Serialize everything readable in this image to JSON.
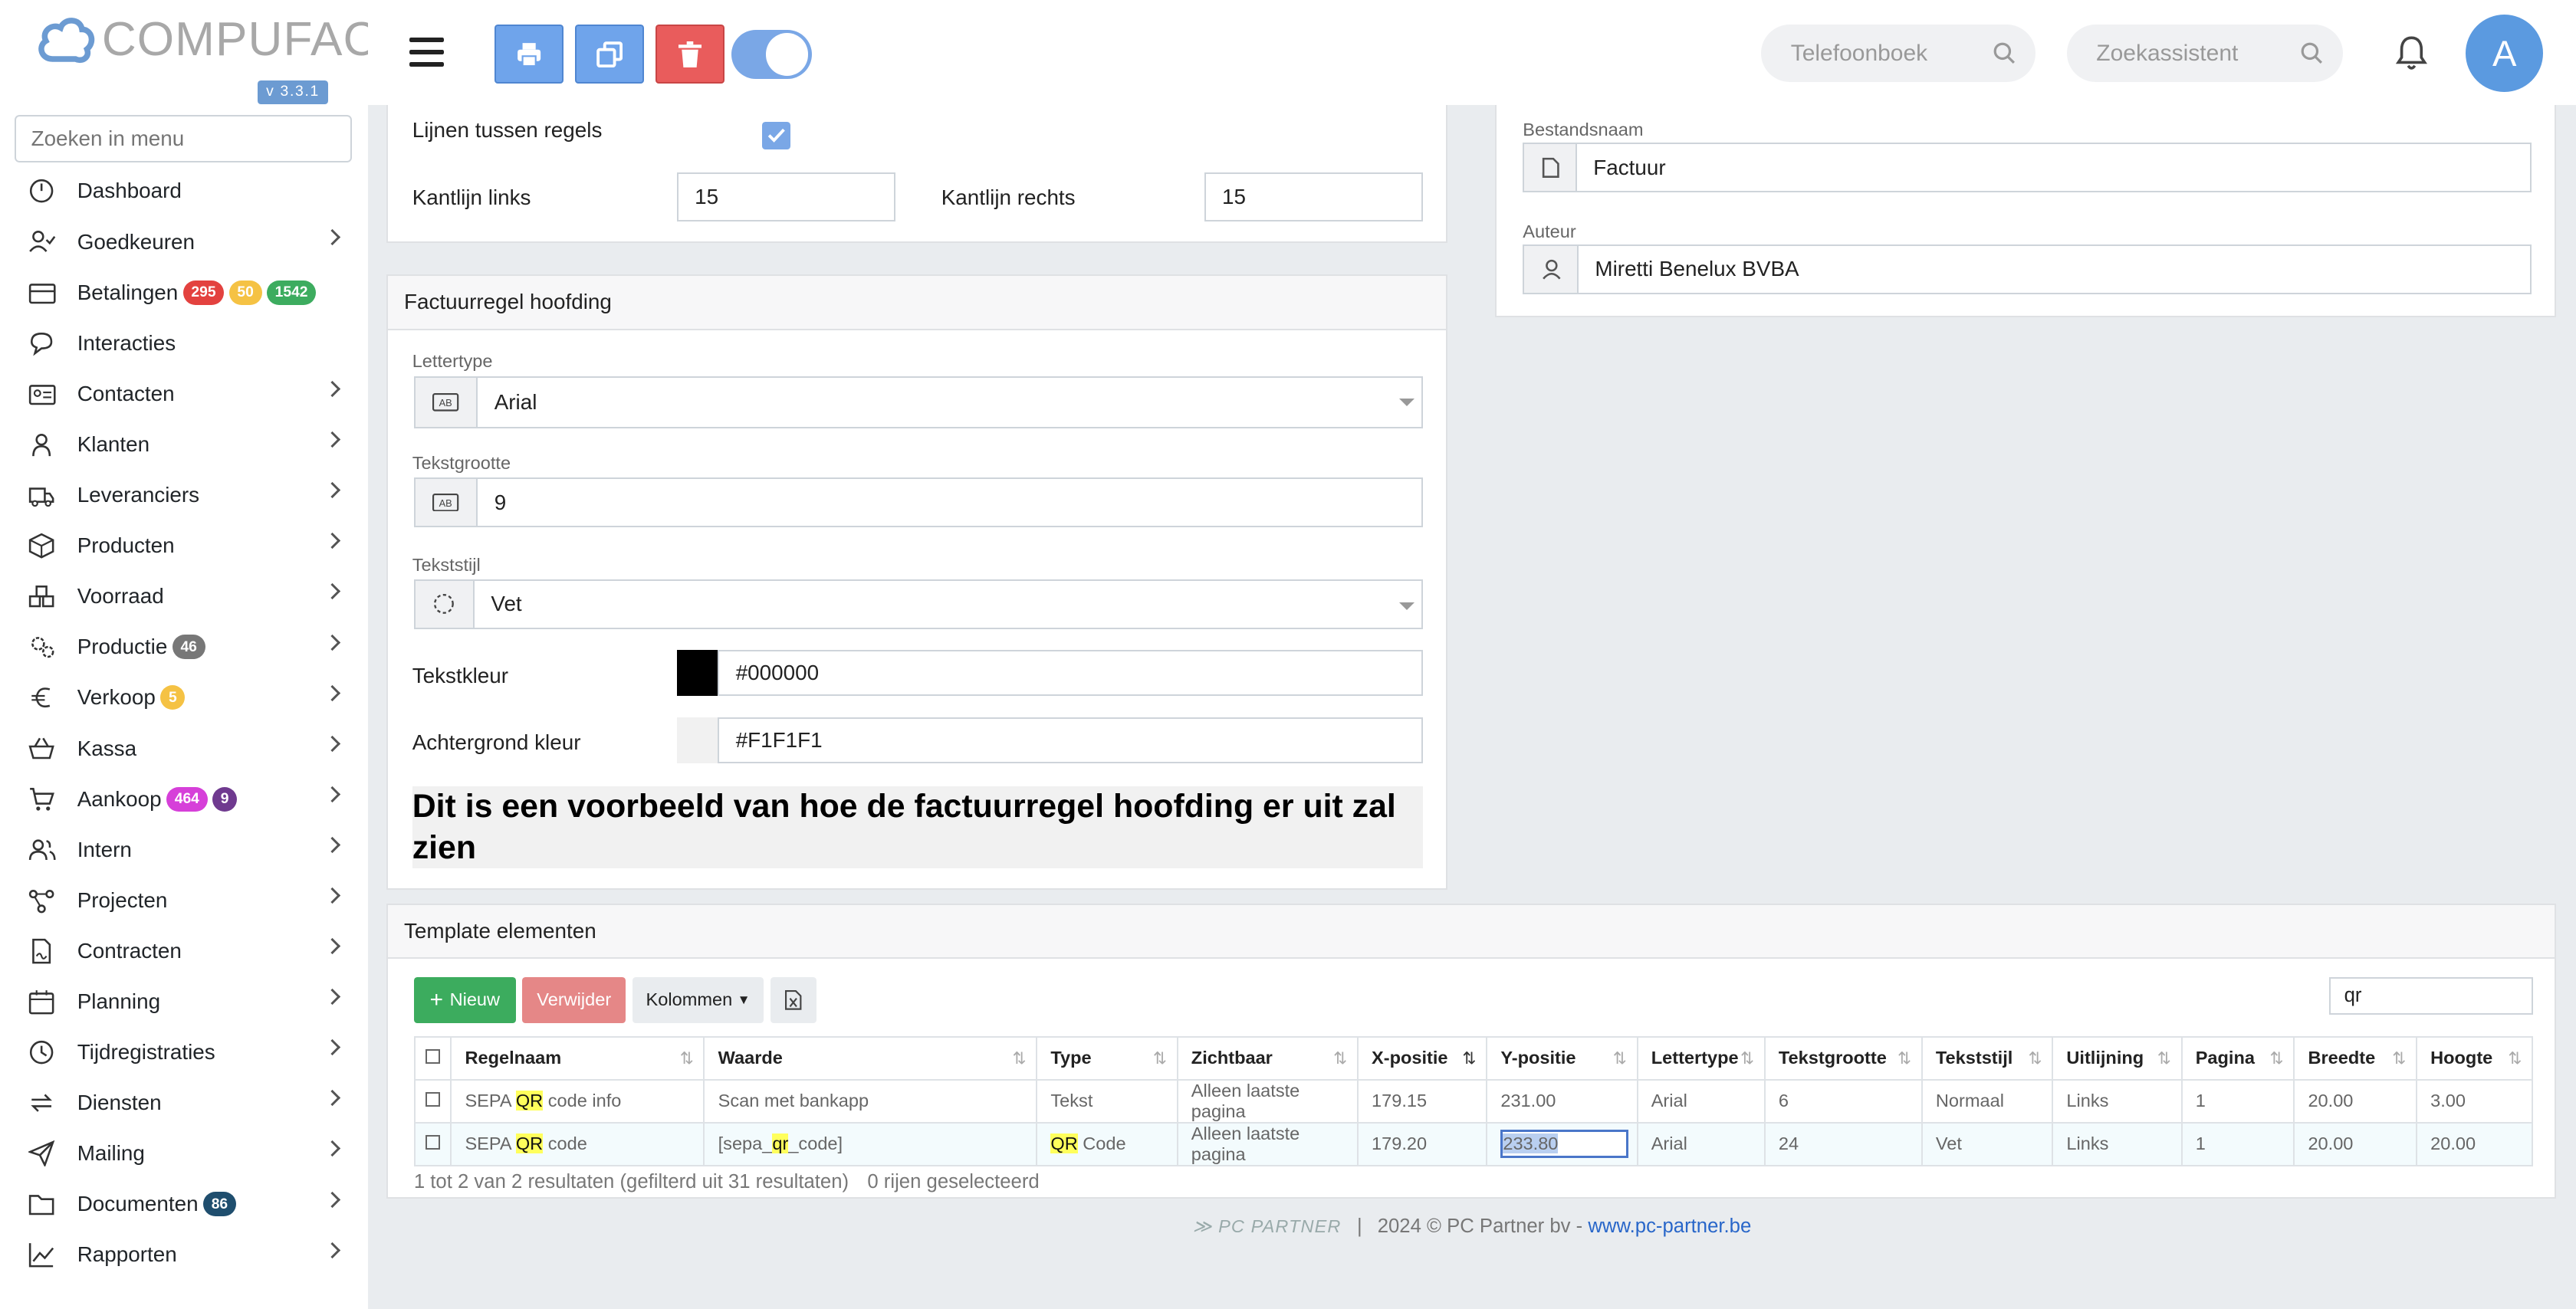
{
  "app": {
    "name": "COMPUFACT",
    "version": "v 3.3.1"
  },
  "sidebar": {
    "search_placeholder": "Zoeken in menu",
    "items": [
      {
        "label": "Dashboard",
        "icon": "dashboard-icon",
        "chevron": false,
        "badges": []
      },
      {
        "label": "Goedkeuren",
        "icon": "user-check-icon",
        "chevron": true,
        "badges": []
      },
      {
        "label": "Betalingen",
        "icon": "credit-card-icon",
        "chevron": false,
        "badges": [
          {
            "text": "295",
            "color": "#e3423f"
          },
          {
            "text": "50",
            "color": "#f5c244"
          },
          {
            "text": "1542",
            "color": "#3dac5f"
          }
        ]
      },
      {
        "label": "Interacties",
        "icon": "chat-icon",
        "chevron": false,
        "badges": []
      },
      {
        "label": "Contacten",
        "icon": "contact-card-icon",
        "chevron": true,
        "badges": []
      },
      {
        "label": "Klanten",
        "icon": "customer-icon",
        "chevron": true,
        "badges": []
      },
      {
        "label": "Leveranciers",
        "icon": "truck-icon",
        "chevron": true,
        "badges": []
      },
      {
        "label": "Producten",
        "icon": "box-icon",
        "chevron": true,
        "badges": []
      },
      {
        "label": "Voorraad",
        "icon": "boxes-icon",
        "chevron": true,
        "badges": []
      },
      {
        "label": "Productie",
        "icon": "gears-icon",
        "chevron": true,
        "badges": [
          {
            "text": "46",
            "color": "#777"
          }
        ]
      },
      {
        "label": "Verkoop",
        "icon": "euro-icon",
        "chevron": true,
        "badges": [
          {
            "text": "5",
            "color": "#f5c244"
          }
        ]
      },
      {
        "label": "Kassa",
        "icon": "basket-icon",
        "chevron": true,
        "badges": []
      },
      {
        "label": "Aankoop",
        "icon": "cart-icon",
        "chevron": true,
        "badges": [
          {
            "text": "464",
            "color": "#d63fd9"
          },
          {
            "text": "9",
            "color": "#6f3a8f"
          }
        ]
      },
      {
        "label": "Intern",
        "icon": "users-icon",
        "chevron": true,
        "badges": []
      },
      {
        "label": "Projecten",
        "icon": "project-icon",
        "chevron": true,
        "badges": []
      },
      {
        "label": "Contracten",
        "icon": "contract-icon",
        "chevron": true,
        "badges": []
      },
      {
        "label": "Planning",
        "icon": "calendar-icon",
        "chevron": true,
        "badges": []
      },
      {
        "label": "Tijdregistraties",
        "icon": "clock-icon",
        "chevron": true,
        "badges": []
      },
      {
        "label": "Diensten",
        "icon": "repeat-icon",
        "chevron": true,
        "badges": []
      },
      {
        "label": "Mailing",
        "icon": "send-icon",
        "chevron": true,
        "badges": []
      },
      {
        "label": "Documenten",
        "icon": "folder-icon",
        "chevron": true,
        "badges": [
          {
            "text": "86",
            "color": "#1f4e6e"
          }
        ]
      },
      {
        "label": "Rapporten",
        "icon": "chart-line-icon",
        "chevron": true,
        "badges": []
      }
    ]
  },
  "topbar": {
    "search1_placeholder": "Telefoonboek",
    "search2_placeholder": "Zoekassistent",
    "avatar_initial": "A",
    "colors": {
      "print": "#6fa4eb",
      "copy": "#6fa4eb",
      "delete": "#e95c5c",
      "toggle": "#7aa7e6"
    }
  },
  "settings_top": {
    "lines_label": "Lijnen tussen regels",
    "margin_left_label": "Kantlijn links",
    "margin_left_value": "15",
    "margin_right_label": "Kantlijn rechts",
    "margin_right_value": "15"
  },
  "file": {
    "filename_label": "Bestandsnaam",
    "filename_value": "Factuur",
    "author_label": "Auteur",
    "author_value": "Miretti Benelux BVBA"
  },
  "header_card": {
    "title": "Factuurregel hoofding",
    "font_label": "Lettertype",
    "font_value": "Arial",
    "size_label": "Tekstgrootte",
    "size_value": "9",
    "style_label": "Tekststijl",
    "style_value": "Vet",
    "color_label": "Tekstkleur",
    "color_value": "#000000",
    "bg_label": "Achtergrond kleur",
    "bg_value": "#F1F1F1",
    "preview": "Dit is een voorbeeld van hoe de factuurregel hoofding er uit zal zien"
  },
  "elements": {
    "title": "Template elementen",
    "new_label": "Nieuw",
    "delete_label": "Verwijder",
    "columns_label": "Kolommen",
    "search_value": "qr",
    "headers": [
      "Regelnaam",
      "Waarde",
      "Type",
      "Zichtbaar",
      "X-positie",
      "Y-positie",
      "Lettertype",
      "Tekstgrootte",
      "Tekststijl",
      "Uitlijning",
      "Pagina",
      "Breedte",
      "Hoogte"
    ],
    "rows": [
      {
        "pre": "SEPA ",
        "hl": "QR",
        "post": " code info",
        "waarde_pre": "Scan met bankapp",
        "waarde_hl": "",
        "waarde_post": "",
        "type_hl": "",
        "type_post": "Tekst",
        "zichtbaar": "Alleen laatste pagina",
        "x": "179.15",
        "y": "231.00",
        "font": "Arial",
        "size": "6",
        "style": "Normaal",
        "align": "Links",
        "page": "1",
        "w": "20.00",
        "h": "3.00"
      },
      {
        "pre": "SEPA ",
        "hl": "QR",
        "post": " code",
        "waarde_pre": "[sepa_",
        "waarde_hl": "qr",
        "waarde_post": "_code]",
        "type_hl": "QR",
        "type_post": " Code",
        "zichtbaar": "Alleen laatste pagina",
        "x": "179.20",
        "y": "233.80",
        "font": "Arial",
        "size": "24",
        "style": "Vet",
        "align": "Links",
        "page": "1",
        "w": "20.00",
        "h": "20.00"
      }
    ],
    "info": "1 tot 2 van 2 resultaten (gefilterd uit 31 resultaten)",
    "selected": "0 rijen geselecteerd"
  },
  "footer": {
    "brand": "PC PARTNER",
    "sep": "|",
    "copyright": "2024 © PC Partner bv -",
    "link": "www.pc-partner.be"
  }
}
